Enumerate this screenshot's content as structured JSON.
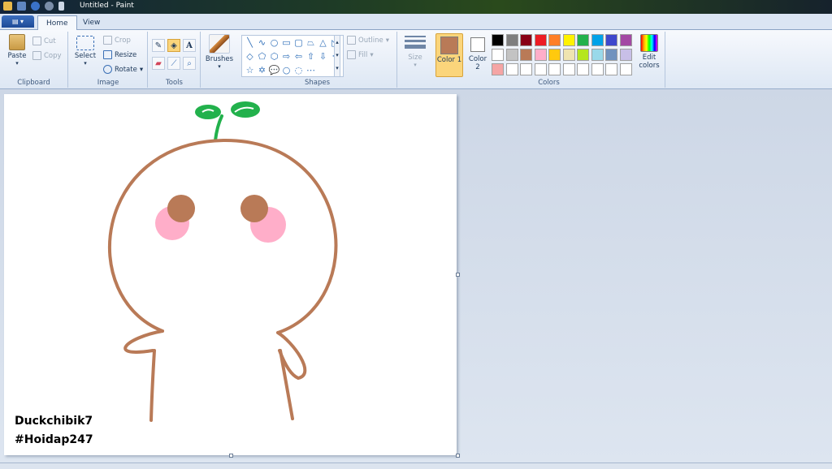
{
  "window": {
    "title": "Untitled - Paint"
  },
  "tabs": [
    {
      "label": "Home"
    },
    {
      "label": "View"
    }
  ],
  "clipboard": {
    "paste": "Paste",
    "cut": "Cut",
    "copy": "Copy",
    "label": "Clipboard"
  },
  "image": {
    "select": "Select",
    "crop": "Crop",
    "resize": "Resize",
    "rotate": "Rotate",
    "label": "Image"
  },
  "tools": {
    "label": "Tools",
    "brushes": "Brushes"
  },
  "shapes": {
    "label": "Shapes",
    "outline": "Outline",
    "fill": "Fill",
    "size": "Size",
    "icons": [
      "╲",
      "∿",
      "○",
      "▭",
      "▢",
      "⏢",
      "△",
      "◺",
      "◇",
      "⬠",
      "⬡",
      "⇨",
      "⇦",
      "⇧",
      "⇩",
      "✦",
      "☆",
      "✡",
      "💬",
      "○",
      "◌",
      "⋯"
    ]
  },
  "colors": {
    "color1": "Color 1",
    "color1_value": "#b97a57",
    "color2": "Color 2",
    "color2_value": "#ffffff",
    "edit": "Edit colors",
    "label": "Colors",
    "palette_row1": [
      "#000000",
      "#7f7f7f",
      "#880015",
      "#ed1c24",
      "#ff7f27",
      "#fff200",
      "#22b14c",
      "#00a2e8",
      "#3f48cc",
      "#a349a4"
    ],
    "palette_row2": [
      "#ffffff",
      "#c3c3c3",
      "#b97a57",
      "#ffaec9",
      "#ffc90e",
      "#efe4b0",
      "#b5e61d",
      "#99d9ea",
      "#7092be",
      "#c8bfe7"
    ],
    "palette_row3": [
      "#f5a5a5",
      "#ffffff",
      "#ffffff",
      "#ffffff",
      "#ffffff",
      "#ffffff",
      "#ffffff",
      "#ffffff",
      "#ffffff",
      "#ffffff"
    ]
  },
  "canvas": {
    "caption_line1": "Duckchibik7",
    "caption_line2": "#Hoidap247"
  }
}
